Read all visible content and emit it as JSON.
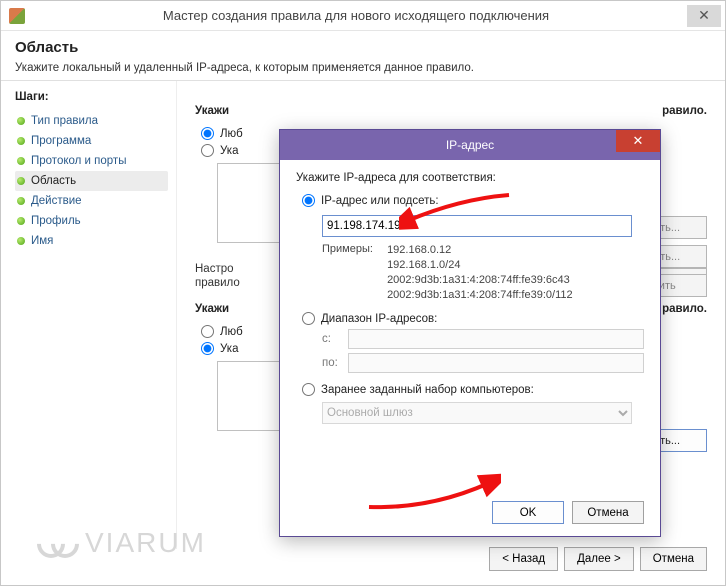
{
  "window": {
    "title": "Мастер создания правила для нового исходящего подключения",
    "close_glyph": "✕"
  },
  "header": {
    "title": "Область",
    "subtitle": "Укажите локальный и удаленный IP-адреса, к которым применяется данное правило."
  },
  "steps": {
    "title": "Шаги:",
    "items": [
      {
        "label": "Тип правила"
      },
      {
        "label": "Программа"
      },
      {
        "label": "Протокол и порты"
      },
      {
        "label": "Область"
      },
      {
        "label": "Действие"
      },
      {
        "label": "Профиль"
      },
      {
        "label": "Имя"
      }
    ],
    "current_index": 3
  },
  "main": {
    "section1_label": "Укажи",
    "section1_trailing": "равило.",
    "radio_any": "Люб",
    "radio_specified": "Ука",
    "settings_hint": "Настро",
    "settings_hint2": "правило",
    "section2_trailing": "роить...",
    "section3_label": "Укажи",
    "section3_trailing": "равило.",
    "buttons": {
      "add": "авить...",
      "edit": "енить...",
      "delete": "алить",
      "add_full": "Добавить..."
    }
  },
  "modal": {
    "title": "IP-адрес",
    "close_glyph": "✕",
    "prompt": "Укажите IP-адреса для соответствия:",
    "opt_ip_label": "IP-адрес или подсеть:",
    "ip_value": "91.198.174.192",
    "examples_label": "Примеры:",
    "examples": [
      "192.168.0.12",
      "192.168.1.0/24",
      "2002:9d3b:1a31:4:208:74ff:fe39:6c43",
      "2002:9d3b:1a31:4:208:74ff:fe39:0/112"
    ],
    "opt_range_label": "Диапазон IP-адресов:",
    "range_from_label": "с:",
    "range_to_label": "по:",
    "opt_predef_label": "Заранее заданный набор компьютеров:",
    "predef_value": "Основной шлюз",
    "ok_label": "OK",
    "cancel_label": "Отмена"
  },
  "footer": {
    "back": "< Назад",
    "next": "Далее >",
    "cancel": "Отмена"
  },
  "watermark": {
    "text": "VIARUM"
  }
}
